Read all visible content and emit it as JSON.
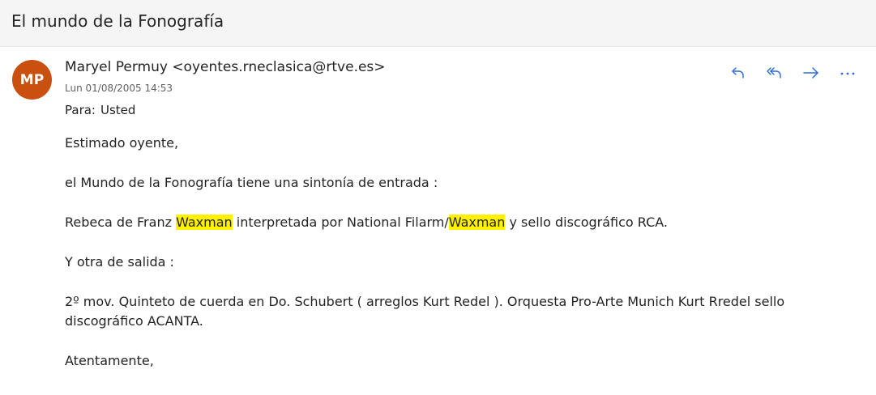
{
  "subject": "El mundo de la Fonografía",
  "sender": {
    "initials": "MP",
    "name_email": "Maryel Permuy <oyentes.rneclasica@rtve.es>",
    "date": "Lun 01/08/2005 14:53",
    "to_label": "Para:",
    "to_value": "Usted"
  },
  "colors": {
    "avatar": "#ca5010",
    "action_icons": "#2b6cd4",
    "highlight": "#fff100"
  },
  "actions": [
    {
      "icon": "reply-icon"
    },
    {
      "icon": "reply-all-icon"
    },
    {
      "icon": "forward-icon"
    },
    {
      "icon": "more-icon"
    }
  ],
  "body": {
    "greeting": "Estimado oyente,",
    "line1": "el Mundo de la Fonografía tiene una sintonía de entrada  :",
    "line2": {
      "part1": "Rebeca  de Franz ",
      "hl1": "Waxman",
      "part2": " interpretada por National Filarm/",
      "hl2": "Waxman",
      "part3": " y sello discográfico RCA."
    },
    "line3": "Y otra  de salida :",
    "line4": "2º mov. Quinteto de cuerda en Do.  Schubert ( arreglos Kurt Redel ). Orquesta Pro-Arte Munich Kurt Rredel sello discográfico ACANTA.",
    "closing": "Atentamente,"
  }
}
